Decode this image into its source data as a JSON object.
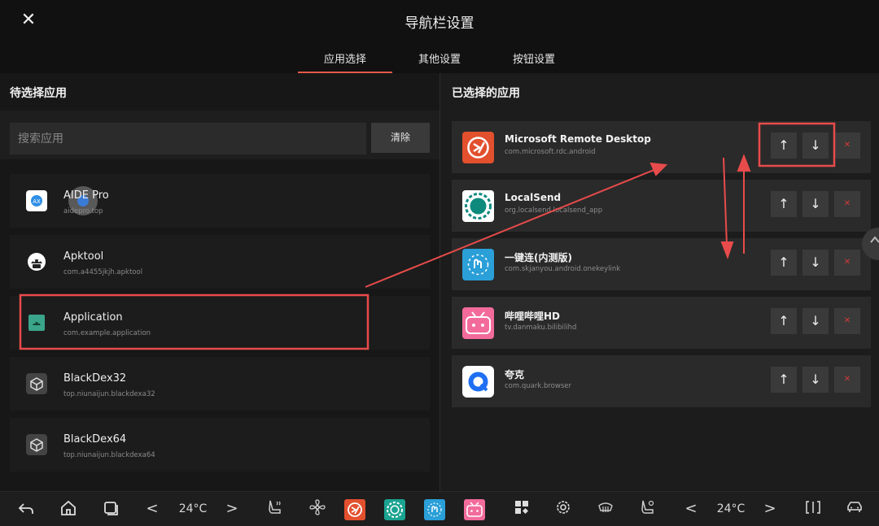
{
  "header": {
    "close_glyph": "✕",
    "title": "导航栏设置",
    "tabs": [
      "应用选择",
      "其他设置",
      "按钮设置"
    ],
    "active_tab": "应用选择"
  },
  "left_pane": {
    "title": "待选择应用",
    "search_placeholder": "搜索应用",
    "clear_label": "清除",
    "apps": [
      {
        "name": "AIDE Pro",
        "package": "aidepro.top",
        "icon": "aide-pro-icon"
      },
      {
        "name": "Apktool",
        "package": "com.a4455jkjh.apktool",
        "icon": "android-robot-icon"
      },
      {
        "name": "Application",
        "package": "com.example.application",
        "icon": "android-app-icon"
      },
      {
        "name": "BlackDex32",
        "package": "top.niunaijun.blackdexa32",
        "icon": "cube-icon"
      },
      {
        "name": "BlackDex64",
        "package": "top.niunaijun.blackdexa64",
        "icon": "cube-icon"
      }
    ]
  },
  "right_pane": {
    "title": "已选择的应用",
    "selected": [
      {
        "name": "Microsoft Remote Desktop",
        "package": "com.microsoft.rdc.android",
        "icon": "remote-desktop-icon"
      },
      {
        "name": "LocalSend",
        "package": "org.localsend.localsend_app",
        "icon": "localsend-icon"
      },
      {
        "name": "一键连(内测版)",
        "package": "com.skjanyou.android.onekeylink",
        "icon": "onekeylink-icon"
      },
      {
        "name": "哔哩哔哩HD",
        "package": "tv.danmaku.bilibilihd",
        "icon": "bilibili-icon"
      },
      {
        "name": "夸克",
        "package": "com.quark.browser",
        "icon": "quark-icon"
      }
    ],
    "up_glyph": "↑",
    "down_glyph": "↓",
    "remove_glyph": "✕"
  },
  "bottom_bar": {
    "left_temp": "24°C",
    "right_temp": "24°C",
    "glyphs": {
      "back": "↶",
      "prev": "<",
      "next": ">"
    }
  },
  "colors": {
    "accent": "#e35a48",
    "annotation_red": "#e84b4b",
    "remove_red": "#d23a3a"
  }
}
